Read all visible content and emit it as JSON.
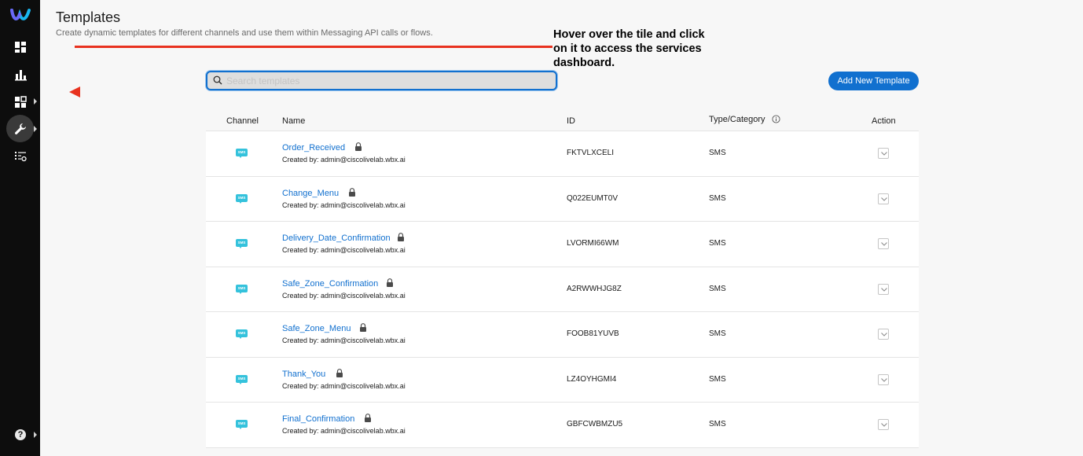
{
  "page": {
    "title": "Templates",
    "subtitle": "Create dynamic templates for different channels and use them within Messaging API calls or flows."
  },
  "search": {
    "placeholder": "Search templates",
    "value": ""
  },
  "add_button_label": "Add New Template",
  "annotation": "Hover over the tile and click on it to access the services dashboard.",
  "colors": {
    "accent": "#1170cf",
    "arrow": "#e8321f",
    "sms": "#34c2dc",
    "sidebar": "#0d0d0d"
  },
  "sidebar": {
    "items": [
      {
        "icon": "dashboard-tiles-icon"
      },
      {
        "icon": "analytics-icon"
      },
      {
        "icon": "apps-icon"
      },
      {
        "icon": "wrench-icon"
      },
      {
        "icon": "list-icon"
      },
      {
        "icon": "help-icon",
        "label": "?"
      }
    ]
  },
  "table": {
    "headers": {
      "channel": "Channel",
      "name": "Name",
      "id": "ID",
      "type": "Type/Category",
      "action": "Action"
    },
    "rows": [
      {
        "channel_icon": "SMS",
        "name": "Order_Received",
        "created_by": "Created by: admin@ciscolivelab.wbx.ai",
        "id": "FKTVLXCELI",
        "type": "SMS"
      },
      {
        "channel_icon": "SMS",
        "name": "Change_Menu",
        "created_by": "Created by: admin@ciscolivelab.wbx.ai",
        "id": "Q022EUMT0V",
        "type": "SMS"
      },
      {
        "channel_icon": "SMS",
        "name": "Delivery_Date_Confirmation",
        "created_by": "Created by: admin@ciscolivelab.wbx.ai",
        "id": "LVORMI66WM",
        "type": "SMS"
      },
      {
        "channel_icon": "SMS",
        "name": "Safe_Zone_Confirmation",
        "created_by": "Created by: admin@ciscolivelab.wbx.ai",
        "id": "A2RWWHJG8Z",
        "type": "SMS"
      },
      {
        "channel_icon": "SMS",
        "name": "Safe_Zone_Menu",
        "created_by": "Created by: admin@ciscolivelab.wbx.ai",
        "id": "FOOB81YUVB",
        "type": "SMS"
      },
      {
        "channel_icon": "SMS",
        "name": "Thank_You",
        "created_by": "Created by: admin@ciscolivelab.wbx.ai",
        "id": "LZ4OYHGMI4",
        "type": "SMS"
      },
      {
        "channel_icon": "SMS",
        "name": "Final_Confirmation",
        "created_by": "Created by: admin@ciscolivelab.wbx.ai",
        "id": "GBFCWBMZU5",
        "type": "SMS"
      }
    ]
  }
}
